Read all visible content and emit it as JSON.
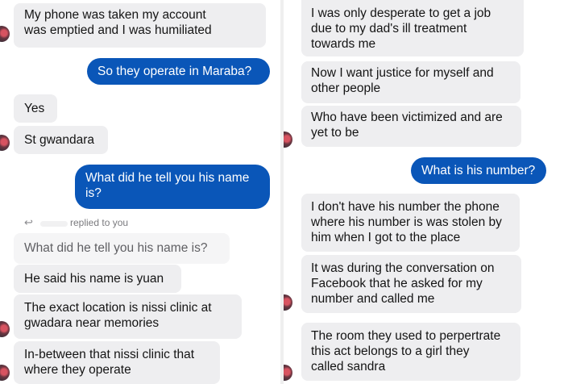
{
  "conversation": {
    "left": {
      "messages": [
        {
          "text": "My phone was taken my account\nwas emptied and I was humiliated"
        },
        {
          "text": "So they operate in Maraba?"
        },
        {
          "text": "Yes"
        },
        {
          "text": "St gwandara"
        },
        {
          "text": "What did he tell you his name\nis?"
        },
        {
          "text": "He said his name is yuan"
        },
        {
          "text": "The exact location is nissi clinic at\ngwadara near memories"
        },
        {
          "text": "In-between that nissi clinic that\nwhere they operate"
        }
      ],
      "reply_indicator": {
        "icon": "reply-arrow-icon",
        "label": "replied to you",
        "quoted_text": "What did he tell you his name is?"
      }
    },
    "right": {
      "messages": [
        {
          "text": "I was only desperate to get a job\ndue to my dad's ill treatment\ntowards me"
        },
        {
          "text": "Now I want justice for myself and\nother people"
        },
        {
          "text": "Who have been victimized and are\nyet to be"
        },
        {
          "text": "What is his number?"
        },
        {
          "text": "I don't have his number the phone\nwhere his number is was stolen by\nhim when I got to the place"
        },
        {
          "text": "It was during the conversation on\nFacebook that he asked for my\nnumber and called me"
        },
        {
          "text": "The room they used to perpertrate\nthis act belongs to a girl they\ncalled sandra"
        }
      ]
    }
  },
  "colors": {
    "sent_bubble": "#0a56b8",
    "received_bubble": "#eeeef0",
    "quoted_bubble": "#f5f5f6",
    "sent_text": "#ffffff",
    "received_text": "#141414"
  }
}
